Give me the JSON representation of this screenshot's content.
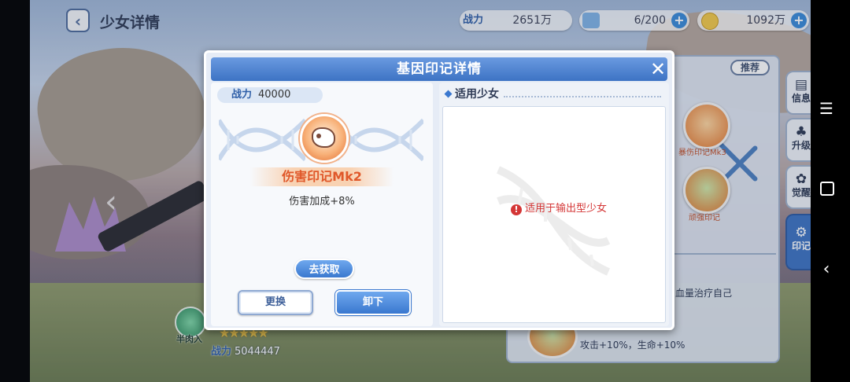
{
  "top_bar": {
    "title": "少女详情",
    "power_label": "战力",
    "power_value": "2651万",
    "tickets_value": "6/200",
    "gold_value": "1092万"
  },
  "modal": {
    "title": "基因印记详情",
    "power_label": "战力",
    "power_value": "40000",
    "gene_name": "伤害印记Mk2",
    "gene_effect": "伤害加成+8%",
    "obtain_button": "去获取",
    "replace_button": "更换",
    "unload_button": "卸下",
    "applicable_heading": "适用少女",
    "applicable_note": "适用于输出型少女"
  },
  "background_panel": {
    "recommend_label": "推荐",
    "node1_label": "暴伤印记Mk3",
    "node2_label": "顽强印记",
    "text1": "血量治疗自己",
    "text2": "攻击+10%，生命+10%"
  },
  "side_tabs": [
    {
      "label": "信息",
      "icon": "info-icon"
    },
    {
      "label": "升级",
      "icon": "levelup-icon"
    },
    {
      "label": "觉醒",
      "icon": "awaken-icon"
    },
    {
      "label": "印记",
      "icon": "imprint-icon",
      "active": true
    }
  ],
  "character": {
    "role": "半肉入",
    "stars": 5,
    "power_label": "战力",
    "power_value": "5044447"
  },
  "colors": {
    "accent_blue": "#3d73c4",
    "gene_name_orange": "#e0582a",
    "warning_red": "#d43636"
  }
}
